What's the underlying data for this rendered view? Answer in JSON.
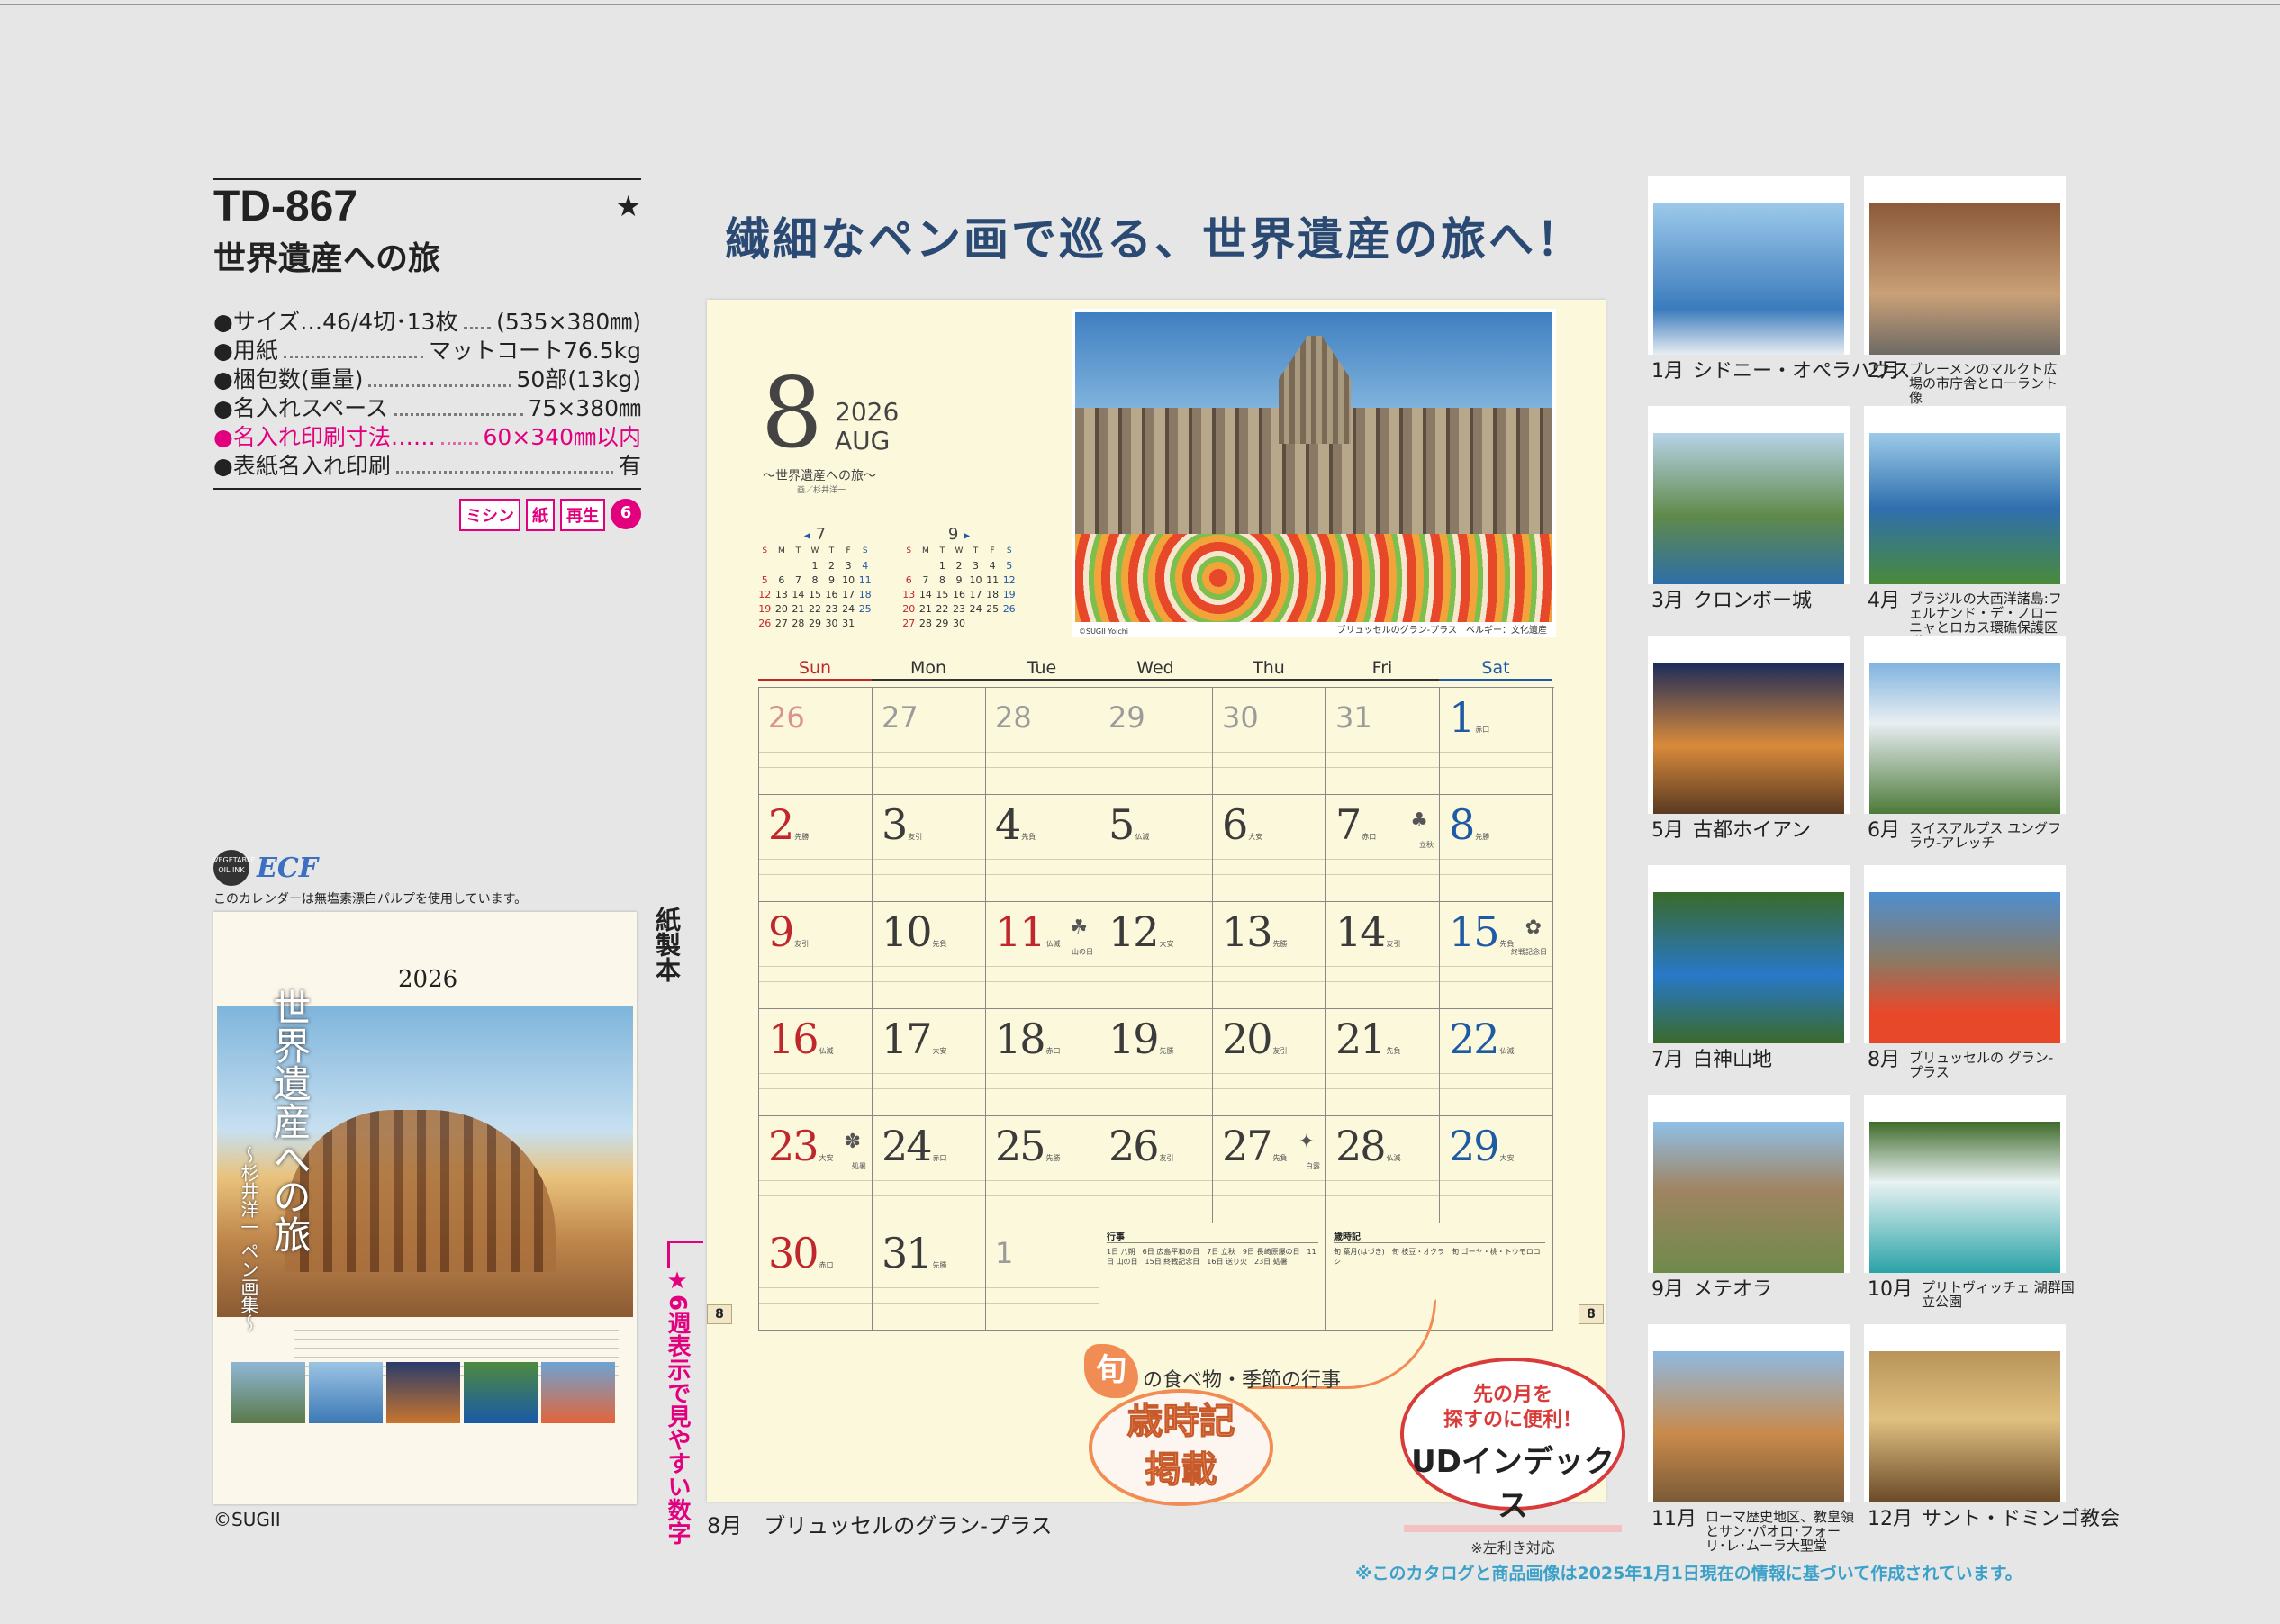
{
  "spec": {
    "code": "TD-867",
    "star": "★",
    "title": "世界遺産への旅",
    "rows": [
      {
        "label": "●サイズ…46/4切･13枚",
        "value": "(535×380㎜)",
        "pink": false
      },
      {
        "label": "●用紙",
        "value": "マットコート76.5kg",
        "pink": false
      },
      {
        "label": "●梱包数(重量)",
        "value": "50部(13kg)",
        "pink": false
      },
      {
        "label": "●名入れスペース",
        "value": "75×380㎜",
        "pink": false
      },
      {
        "label": "●名入れ印刷寸法……",
        "value": "60×340㎜以内",
        "pink": true
      },
      {
        "label": "●表紙名入れ印刷",
        "value": "有",
        "pink": false
      }
    ],
    "badges": [
      "ミシン",
      "紙",
      "再生",
      "6"
    ]
  },
  "ecf": {
    "veg": "VEGETABLE OIL INK",
    "logo": "ECF",
    "note": "このカレンダーは無塩素漂白パルプを使用しています。"
  },
  "cover": {
    "year": "2026",
    "title": "世界遺産への旅",
    "subtitle": "～杉井洋一 ペン画集～"
  },
  "copyright": "©SUGII",
  "paper_binding": "紙製本",
  "six_weeks": "★6週表示で見やすい数字",
  "headline": "繊細なペン画で巡る、世界遺産の旅へ！",
  "calendar": {
    "month_num": "8",
    "year": "2026",
    "month_name": "AUG",
    "series": "～世界遺産への旅～",
    "series_sub": "画／杉井洋一",
    "prev": {
      "label": "7",
      "arrow": "◂",
      "head": [
        "S",
        "M",
        "T",
        "W",
        "T",
        "F",
        "S"
      ],
      "weeks": [
        [
          "",
          "",
          "",
          "1",
          "2",
          "3",
          "4"
        ],
        [
          "5",
          "6",
          "7",
          "8",
          "9",
          "10",
          "11"
        ],
        [
          "12",
          "13",
          "14",
          "15",
          "16",
          "17",
          "18"
        ],
        [
          "19",
          "20",
          "21",
          "22",
          "23",
          "24",
          "25"
        ],
        [
          "26",
          "27",
          "28",
          "29",
          "30",
          "31",
          ""
        ]
      ]
    },
    "next": {
      "label": "9",
      "arrow": "▸",
      "head": [
        "S",
        "M",
        "T",
        "W",
        "T",
        "F",
        "S"
      ],
      "weeks": [
        [
          "",
          "",
          "1",
          "2",
          "3",
          "4",
          "5"
        ],
        [
          "6",
          "7",
          "8",
          "9",
          "10",
          "11",
          "12"
        ],
        [
          "13",
          "14",
          "15",
          "16",
          "17",
          "18",
          "19"
        ],
        [
          "20",
          "21",
          "22",
          "23",
          "24",
          "25",
          "26"
        ],
        [
          "27",
          "28",
          "29",
          "30",
          "",
          "",
          ""
        ]
      ]
    },
    "painting_caption": "ブリュッセルのグラン-プラス　ベルギー：文化遺産",
    "painting_copy": "©SUGII Yoichi",
    "weekdays": [
      "Sun",
      "Mon",
      "Tue",
      "Wed",
      "Thu",
      "Fri",
      "Sat"
    ],
    "days": [
      {
        "n": "26",
        "dim": true
      },
      {
        "n": "27",
        "dim": true
      },
      {
        "n": "28",
        "dim": true
      },
      {
        "n": "29",
        "dim": true
      },
      {
        "n": "30",
        "dim": true
      },
      {
        "n": "31",
        "dim": true
      },
      {
        "n": "1",
        "rk": "赤口"
      },
      {
        "n": "2",
        "rk": "先勝"
      },
      {
        "n": "3",
        "rk": "友引"
      },
      {
        "n": "4",
        "rk": "先負"
      },
      {
        "n": "5",
        "rk": "仏滅"
      },
      {
        "n": "6",
        "rk": "大安"
      },
      {
        "n": "7",
        "rk": "赤口",
        "glyph": "♣",
        "ev": "立秋"
      },
      {
        "n": "8",
        "rk": "先勝"
      },
      {
        "n": "9",
        "rk": "友引"
      },
      {
        "n": "10",
        "rk": "先負"
      },
      {
        "n": "11",
        "rk": "仏滅",
        "glyph": "☘",
        "ev": "山の日"
      },
      {
        "n": "12",
        "rk": "大安"
      },
      {
        "n": "13",
        "rk": "先勝"
      },
      {
        "n": "14",
        "rk": "友引"
      },
      {
        "n": "15",
        "rk": "先負",
        "glyph": "✿",
        "ev": "終戦記念日"
      },
      {
        "n": "16",
        "rk": "仏滅"
      },
      {
        "n": "17",
        "rk": "大安"
      },
      {
        "n": "18",
        "rk": "赤口"
      },
      {
        "n": "19",
        "rk": "先勝"
      },
      {
        "n": "20",
        "rk": "友引"
      },
      {
        "n": "21",
        "rk": "先負"
      },
      {
        "n": "22",
        "rk": "仏滅"
      },
      {
        "n": "23",
        "rk": "大安",
        "glyph": "✽",
        "ev": "処暑"
      },
      {
        "n": "24",
        "rk": "赤口"
      },
      {
        "n": "25",
        "rk": "先勝"
      },
      {
        "n": "26",
        "rk": "友引"
      },
      {
        "n": "27",
        "rk": "先負",
        "glyph": "✦",
        "ev": "白露"
      },
      {
        "n": "28",
        "rk": "仏滅"
      },
      {
        "n": "29",
        "rk": "大安"
      },
      {
        "n": "30",
        "rk": "赤口"
      },
      {
        "n": "31",
        "rk": "先勝"
      },
      {
        "n": "1",
        "dim": true
      }
    ],
    "events_title": "行事",
    "events": "1日 八朔　6日 広島平和の日　7日 立秋　9日 長崎原爆の日　11日 山の日　15日 終戦記念日　16日 送り火　23日 処暑",
    "saijiki_title": "歳時記",
    "saijiki": "旬 葉月(はづき)　旬 枝豆・オクラ　旬 ゴーヤ・桃・トウモロコシ",
    "index_mark": "8",
    "stamp_jun": "旬",
    "stamp_jun_sub": "の食べ物・季節の行事",
    "stamp_saijiki_l1": "歳時記",
    "stamp_saijiki_l2": "掲載",
    "ud_l1": "先の月を",
    "ud_l2": "探すのに便利！",
    "ud_l3": "UDインデックス",
    "ud_l4": "※左利き対応"
  },
  "calendar_caption": "8月　ブリュッセルのグラン-プラス",
  "thumbs": [
    {
      "month": "1月",
      "name": "シドニー・オペラハウス",
      "small": false
    },
    {
      "month": "2月",
      "name": "ブレーメンのマルクト広場の市庁舎とローラント像",
      "small": true
    },
    {
      "month": "3月",
      "name": "クロンボー城",
      "small": false
    },
    {
      "month": "4月",
      "name": "ブラジルの大西洋諸島:フェルナンド・デ・ノローニャとロカス環礁保護区群",
      "small": true
    },
    {
      "month": "5月",
      "name": "古都ホイアン",
      "small": false
    },
    {
      "month": "6月",
      "name": "スイスアルプス ユングフラウ-アレッチ",
      "small": true
    },
    {
      "month": "7月",
      "name": "白神山地",
      "small": false
    },
    {
      "month": "8月",
      "name": "ブリュッセルの グラン-プラス",
      "small": true
    },
    {
      "month": "9月",
      "name": "メテオラ",
      "small": false
    },
    {
      "month": "10月",
      "name": "プリトヴィッチェ 湖群国立公園",
      "small": true
    },
    {
      "month": "11月",
      "name": "ローマ歴史地区、教皇領とサン･パオロ･フォーリ･レ･ムーラ大聖堂",
      "small": true
    },
    {
      "month": "12月",
      "name": "サント・ドミンゴ教会",
      "small": false
    }
  ],
  "footnote": "※このカタログと商品画像は2025年1月1日現在の情報に基づいて作成されています。"
}
